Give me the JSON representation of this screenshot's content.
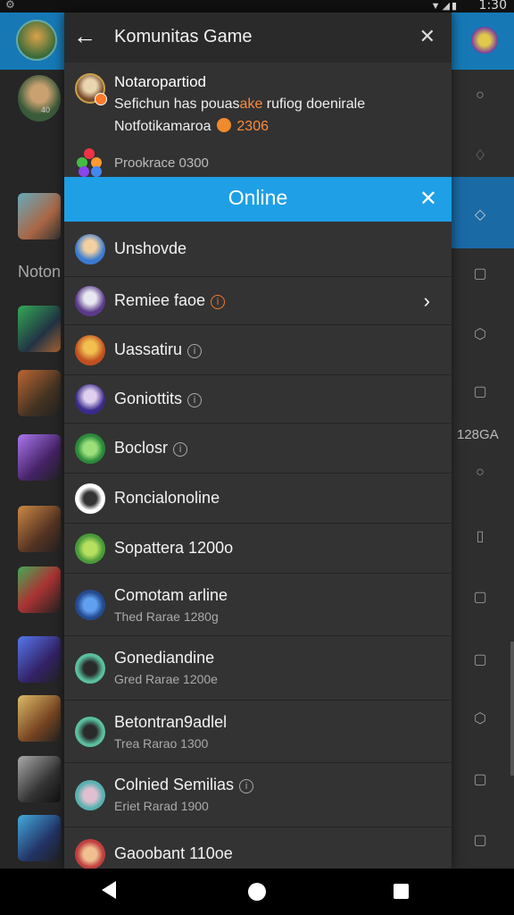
{
  "status_bar": {
    "time": "1:30",
    "icons": "▼◢▮"
  },
  "background": {
    "left_label": "Noton",
    "right_label": "128GA"
  },
  "dialog": {
    "title": "Komunitas Game",
    "info": {
      "name": "Notaropartiod",
      "line1_prefix": "Sefichun has pouas",
      "line1_highlight": "ake",
      "line1_suffix": " rufiog doenirale",
      "line2_prefix": "Notfotikamaroa",
      "line2_number": "2306",
      "line3": "Prookrace 0300"
    },
    "online_label": "Online",
    "items": [
      {
        "name": "Unshovde",
        "sub": "",
        "info": "none"
      },
      {
        "name": "Remiee faoe",
        "sub": "",
        "info": "warn",
        "chevron": true
      },
      {
        "name": "Uassatiru",
        "sub": "",
        "info": "normal"
      },
      {
        "name": "Goniottits",
        "sub": "",
        "info": "normal"
      },
      {
        "name": "Boclosr",
        "sub": "",
        "info": "normal"
      },
      {
        "name": "Roncialonoline",
        "sub": "",
        "info": "none"
      },
      {
        "name": "Sopattera 1200o",
        "sub": "",
        "info": "none"
      },
      {
        "name": "Comotam arline",
        "sub": "Thed Rarae 1280g",
        "info": "none"
      },
      {
        "name": "Gonediandine",
        "sub": "Gred Rarae 1200e",
        "info": "none"
      },
      {
        "name": "Betontran9adlel",
        "sub": "Trea Rarao 1300",
        "info": "none"
      },
      {
        "name": "Colnied Semilias",
        "sub": "Eriet Rarad 1900",
        "info": "normal"
      },
      {
        "name": "Gaoobant 110oe",
        "sub": "",
        "info": "none"
      }
    ]
  },
  "colors": {
    "accent": "#1e9fe6",
    "header_bg": "#1679b5",
    "highlight": "#ff8a3a"
  }
}
